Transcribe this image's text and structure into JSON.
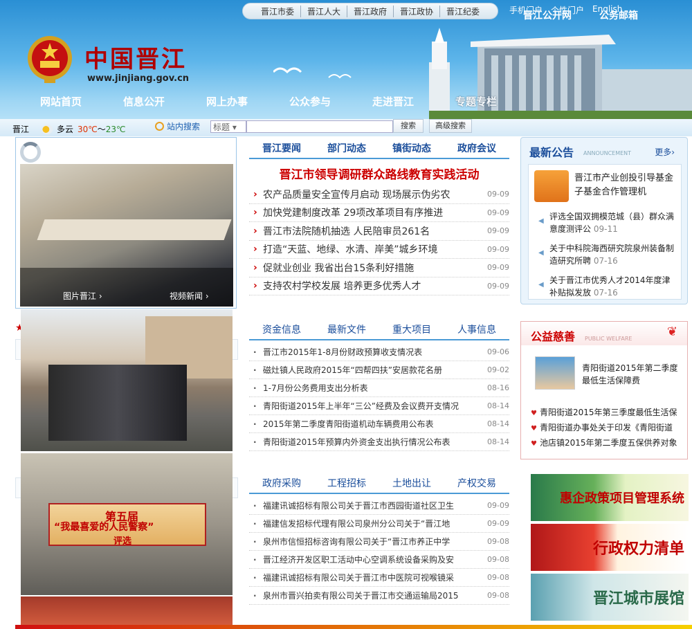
{
  "top_tabs": [
    "晋江市委",
    "晋江人大",
    "晋江政府",
    "晋江政协",
    "晋江纪委"
  ],
  "top_links": [
    "手机门户",
    "个性门户",
    "English"
  ],
  "top_links2": [
    "晋江公开网",
    "公务邮箱"
  ],
  "site": {
    "name": "中国晋江",
    "url": "www.jinjiang.gov.cn"
  },
  "nav": [
    "网站首页",
    "信息公开",
    "网上办事",
    "公众参与",
    "走进晋江",
    "专题专栏"
  ],
  "weather": {
    "city": "晋江",
    "condition": "多云",
    "high": "30℃",
    "sep": "～",
    "low": "23℃"
  },
  "search": {
    "label": "站内搜索",
    "select": "标题",
    "button": "搜索",
    "advanced": "高级搜索"
  },
  "slider": {
    "captions": [
      "图片晋江 ›",
      "视频新闻 ›"
    ]
  },
  "police_banner": {
    "line1": "第五届",
    "line2": "“我最喜爱的人民警察”",
    "line3": "评选"
  },
  "news1": {
    "tabs": [
      "晋江要闻",
      "部门动态",
      "镇街动态",
      "政府会议"
    ],
    "headline": "晋江市领导调研群众路线教育实践活动",
    "items": [
      {
        "title": "农产品质量安全宣传月启动 现场展示伪劣农",
        "date": "09-09"
      },
      {
        "title": "加快党建制度改革 29项改革项目有序推进",
        "date": "09-09"
      },
      {
        "title": "晋江市法院随机抽选 人民陪审员261名",
        "date": "09-09"
      },
      {
        "title": "打造“天蓝、地绿、水清、岸美”城乡环境",
        "date": "09-09"
      },
      {
        "title": "促就业创业 我省出台15条利好措施",
        "date": "09-09"
      },
      {
        "title": "支持农村学校发展 培养更多优秀人才",
        "date": "09-09"
      }
    ]
  },
  "news2": {
    "tabs": [
      "资金信息",
      "最新文件",
      "重大项目",
      "人事信息"
    ],
    "items": [
      {
        "title": "晋江市2015年1-8月份财政预算收支情况表",
        "date": "09-06"
      },
      {
        "title": "磁灶镇人民政府2015年“四帮四扶”安居款花名册",
        "date": "09-02"
      },
      {
        "title": "1-7月份公务费用支出分析表",
        "date": "08-16"
      },
      {
        "title": "青阳街道2015年上半年“三公”经费及会议费开支情况",
        "date": "08-14"
      },
      {
        "title": "2015年第二季度青阳街道机动车辆费用公布表",
        "date": "08-14"
      },
      {
        "title": "青阳街道2015年预算内外资金支出执行情况公布表",
        "date": "08-14"
      }
    ]
  },
  "news3": {
    "tabs": [
      "政府采购",
      "工程招标",
      "土地出让",
      "产权交易"
    ],
    "items": [
      {
        "title": "福建讯诚招标有限公司关于晋江市西园街道社区卫生",
        "date": "09-09"
      },
      {
        "title": "福建信发招标代理有限公司泉州分公司关于“晋江地",
        "date": "09-09"
      },
      {
        "title": "泉州市信恒招标咨询有限公司关于“晋江市养正中学",
        "date": "09-08"
      },
      {
        "title": "晋江经济开发区职工活动中心空调系统设备采购及安",
        "date": "09-08"
      },
      {
        "title": "福建讯诚招标有限公司关于晋江市中医院可视喉镜采",
        "date": "09-08"
      },
      {
        "title": "泉州市晋兴拍卖有限公司关于晋江市交通运输局2015",
        "date": "09-08"
      }
    ]
  },
  "announcements": {
    "title": "最新公告",
    "subtitle": "ANNOUNCEMENT",
    "more": "更多›",
    "featured": "晋江市产业创投引导基金子基金合作管理机",
    "items": [
      {
        "title": "评选全国双拥模范城（县）群众满意度测评公",
        "date": "09-11"
      },
      {
        "title": "关于中科院海西研究院泉州装备制造研究所聘",
        "date": "07-16"
      },
      {
        "title": "关于晋江市优秀人才2014年度津补贴拟发放",
        "date": "07-16"
      }
    ]
  },
  "welfare": {
    "title": "公益慈善",
    "subtitle": "PUBLIC WELFARE",
    "featured": "青阳街道2015年第二季度最低生活保障费",
    "items": [
      "青阳街道2015年第三季度最低生活保",
      "青阳街道办事处关于印发《青阳街道",
      "池店镇2015年第二季度五保供养对象"
    ]
  },
  "banners": [
    "惠企政策项目管理系统",
    "行政权力清单",
    "晋江城市展馆"
  ]
}
